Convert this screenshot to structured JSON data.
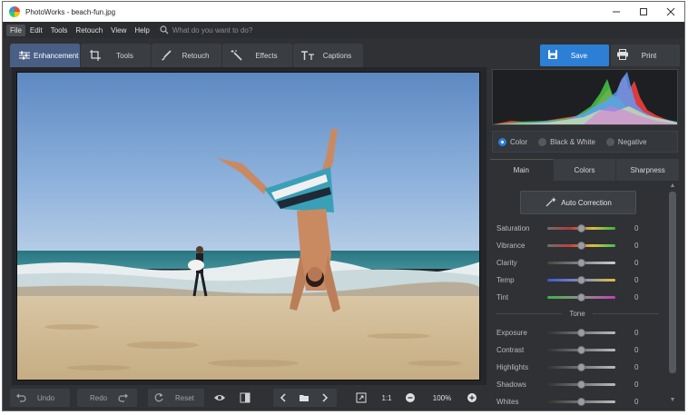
{
  "window": {
    "title": "PhotoWorks - beach-fun.jpg",
    "controls": [
      "minimize",
      "maximize",
      "close"
    ]
  },
  "menubar": {
    "items": [
      "File",
      "Edit",
      "Tools",
      "Retouch",
      "View",
      "Help"
    ],
    "active": "File",
    "search_placeholder": "What do you want to do?"
  },
  "tabs": [
    {
      "label": "Enhancement",
      "icon": "sliders-icon",
      "active": true
    },
    {
      "label": "Tools",
      "icon": "crop-icon",
      "active": false
    },
    {
      "label": "Retouch",
      "icon": "brush-icon",
      "active": false
    },
    {
      "label": "Effects",
      "icon": "magic-wand-icon",
      "active": false
    },
    {
      "label": "Captions",
      "icon": "text-icon",
      "active": false
    }
  ],
  "actions": {
    "save_label": "Save",
    "print_label": "Print"
  },
  "colors": {
    "accent": "#2d7fd6",
    "active_tab": "#4a5f85",
    "background": "#2f3135"
  },
  "modes": {
    "options": [
      "Color",
      "Black & White",
      "Negative"
    ],
    "selected": "Color"
  },
  "panel_tabs": {
    "items": [
      "Main",
      "Colors",
      "Sharpness"
    ],
    "active": "Main"
  },
  "auto_correction_label": "Auto Correction",
  "sliders": [
    {
      "name": "Saturation",
      "value": "0",
      "level": 0.5
    },
    {
      "name": "Vibrance",
      "value": "0",
      "level": 0.5
    },
    {
      "name": "Clarity",
      "value": "0",
      "level": 0.5
    },
    {
      "name": "Temp",
      "value": "0",
      "level": 0.5
    },
    {
      "name": "Tint",
      "value": "0",
      "level": 0.5
    }
  ],
  "tone": {
    "heading": "Tone",
    "sliders": [
      {
        "name": "Exposure",
        "value": "0",
        "level": 0.5
      },
      {
        "name": "Contrast",
        "value": "0",
        "level": 0.5
      },
      {
        "name": "Highlights",
        "value": "0",
        "level": 0.5
      },
      {
        "name": "Shadows",
        "value": "0",
        "level": 0.5
      },
      {
        "name": "Whites",
        "value": "0",
        "level": 0.5
      }
    ]
  },
  "bottombar": {
    "undo_label": "Undo",
    "redo_label": "Redo",
    "reset_label": "Reset",
    "ratio_label": "1:1",
    "zoom_value": "100%"
  }
}
